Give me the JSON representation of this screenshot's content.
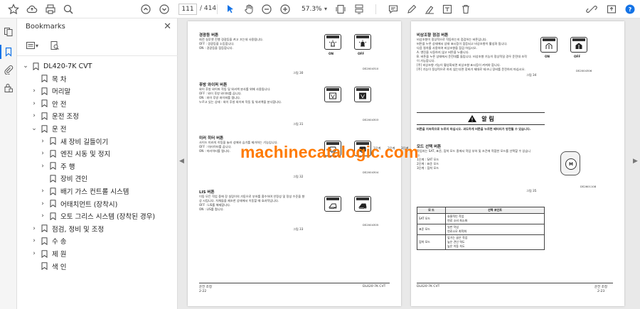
{
  "toolbar": {
    "page_current": "111",
    "page_total": "/ 414",
    "zoom": "57.3%"
  },
  "bookmarks": {
    "title": "Bookmarks",
    "root": "DL420-7K CVT",
    "items": [
      {
        "label": "목 차",
        "has_children": false,
        "expanded": false,
        "indent": 1
      },
      {
        "label": "머리말",
        "has_children": true,
        "expanded": false,
        "indent": 1
      },
      {
        "label": "안 전",
        "has_children": true,
        "expanded": false,
        "indent": 1
      },
      {
        "label": "운전 조정",
        "has_children": true,
        "expanded": false,
        "indent": 1
      },
      {
        "label": "운 전",
        "has_children": true,
        "expanded": true,
        "indent": 1
      },
      {
        "label": "새 장비 길들이기",
        "has_children": true,
        "expanded": false,
        "indent": 2
      },
      {
        "label": "엔진 시동 및 정지",
        "has_children": true,
        "expanded": false,
        "indent": 2
      },
      {
        "label": "주 행",
        "has_children": true,
        "expanded": false,
        "indent": 2
      },
      {
        "label": "장비 견인",
        "has_children": false,
        "expanded": false,
        "indent": 2
      },
      {
        "label": "배기 가스 컨트롤 시스템",
        "has_children": true,
        "expanded": false,
        "indent": 2
      },
      {
        "label": "어태치먼트 (장착시)",
        "has_children": true,
        "expanded": false,
        "indent": 2
      },
      {
        "label": "오토 그리스 시스템 (장착된 경우)",
        "has_children": true,
        "expanded": false,
        "indent": 2
      },
      {
        "label": "점검, 정비 및 조정",
        "has_children": true,
        "expanded": false,
        "indent": 1
      },
      {
        "label": "수 송",
        "has_children": true,
        "expanded": false,
        "indent": 1
      },
      {
        "label": "제 원",
        "has_children": true,
        "expanded": false,
        "indent": 1
      },
      {
        "label": "색 인",
        "has_children": false,
        "expanded": false,
        "indent": 1
      }
    ]
  },
  "left_page": {
    "sections": [
      {
        "title": "경광등 버튼",
        "lines": [
          "회전 실루엣 진행 경광등을 켜고 끄는데 사용됩니다.",
          "OFF : 경광등을 소등합니다.",
          "ON : 경광등을 점등합니다."
        ],
        "figure": "그림 30",
        "code": "DS2004310"
      },
      {
        "title": "후방 와이퍼 버튼",
        "lines": [
          "와이 후방 와이퍼 작동 및 워셔액 분사를 위해 사용됩니다.",
          "OFF : 와이 후방 와이퍼를 끕니다.",
          "ON : 와이 후방 와이퍼를 켭니다.",
          "누르고 있는 상태 : 와이 후방 와이퍼 작동 및 워셔액을 분사합니다."
        ],
        "figure": "그림 31",
        "code": "DS2004303"
      },
      {
        "title": "미러 히터 버튼",
        "lines": [
          "사이드 미러의 히팅을 눌러 성에와 습기를 제거하는 기능입니다.",
          "OFF : 미러히터를 끕니다.",
          "ON : 미러히터를 켭니다."
        ],
        "figure": "그림 32",
        "code": "DS2004304"
      },
      {
        "title": "LIS 버튼",
        "lines": [
          "이동 모든 작업 중에 장 실링이의 가동으로 부하를 흡수하여 안정성 및 정성 수준을 향상 시킵니다. 차체들을 제조한 상태에서 이동할 때 효과적입니다.",
          "OFF : LIS를 해제합니다.",
          "ON : LIS를 켭니다."
        ],
        "figure": "그림 33",
        "code": "DS2004305"
      }
    ],
    "on_label": "ON",
    "off_label": "OFF",
    "footer_left": "운전 조정",
    "footer_page": "2-22",
    "footer_right": "DL420-7K CVT"
  },
  "right_page": {
    "section1": {
      "title": "비상조향 점검 버튼",
      "lines": [
        "비상조향이 정상적으로 작동하는지 점검하는 버튼입니다.",
        "버튼을 누른 상태에서 상태 표시등이 점등되고 비상조향이 활성화 됩니다.",
        "다음 절차를 사용하여 비상조향을 점검 하십시오.",
        "A. 엔진을 시동하지 않고 버튼을 누릅니다.",
        "B. 버튼을 누른 상태에서 운전대를 돌립니다. 비상조향 기능이 정상적일 경우 운전대 조작이 가능합니다.",
        "[주] 비상조향 기능이 활성화되면 비상조향 표시등이 켜져야 합니다.",
        "[주] 기능이 정상적으로 하지 않는다면 장비가 제대로 테크니 장비를 운전하지 마십시오."
      ],
      "figure": "그림 34",
      "code": "DS2004306"
    },
    "warning_title": "알 림",
    "warning_text": "버튼을 지속적으로 누르지 마십시오. 과도하게 버튼을 누르면 배터리가 방전될 수 있습니다.",
    "section2": {
      "title": "모드 선택 버튼",
      "lines": [
        "작업자는 SAT, 표준, 집착 모드 중에서 작업 부하 및 조건에 적합한 모드를 선택할 수 있습니다.",
        "1단계 : SAT 모드",
        "2단계 : 표준 모드",
        "3단계 : 집착 모드"
      ],
      "figure": "그림 35",
      "code": "DS2601108"
    },
    "dial_labels": [
      "1단계",
      "2단계",
      "3단계"
    ],
    "table": {
      "headers": [
        "모 드",
        "선택 포인트"
      ],
      "rows": [
        {
          "mode": "SAT 모드",
          "points": [
            "효율적인 작업",
            "연료 소비 최소화"
          ]
        },
        {
          "mode": "표준 모드",
          "points": [
            "일반 작업",
            "연료소모 최적화"
          ]
        },
        {
          "mode": "집착 모드",
          "points": [
            "앞가는 골은 작업",
            "높은 견인 력도",
            "높은 이동 속도"
          ]
        }
      ]
    },
    "footer_left": "DL420-7K CVT",
    "footer_right": "운전 조정",
    "footer_page": "2-23"
  },
  "watermark": "machinecatalogic.com"
}
